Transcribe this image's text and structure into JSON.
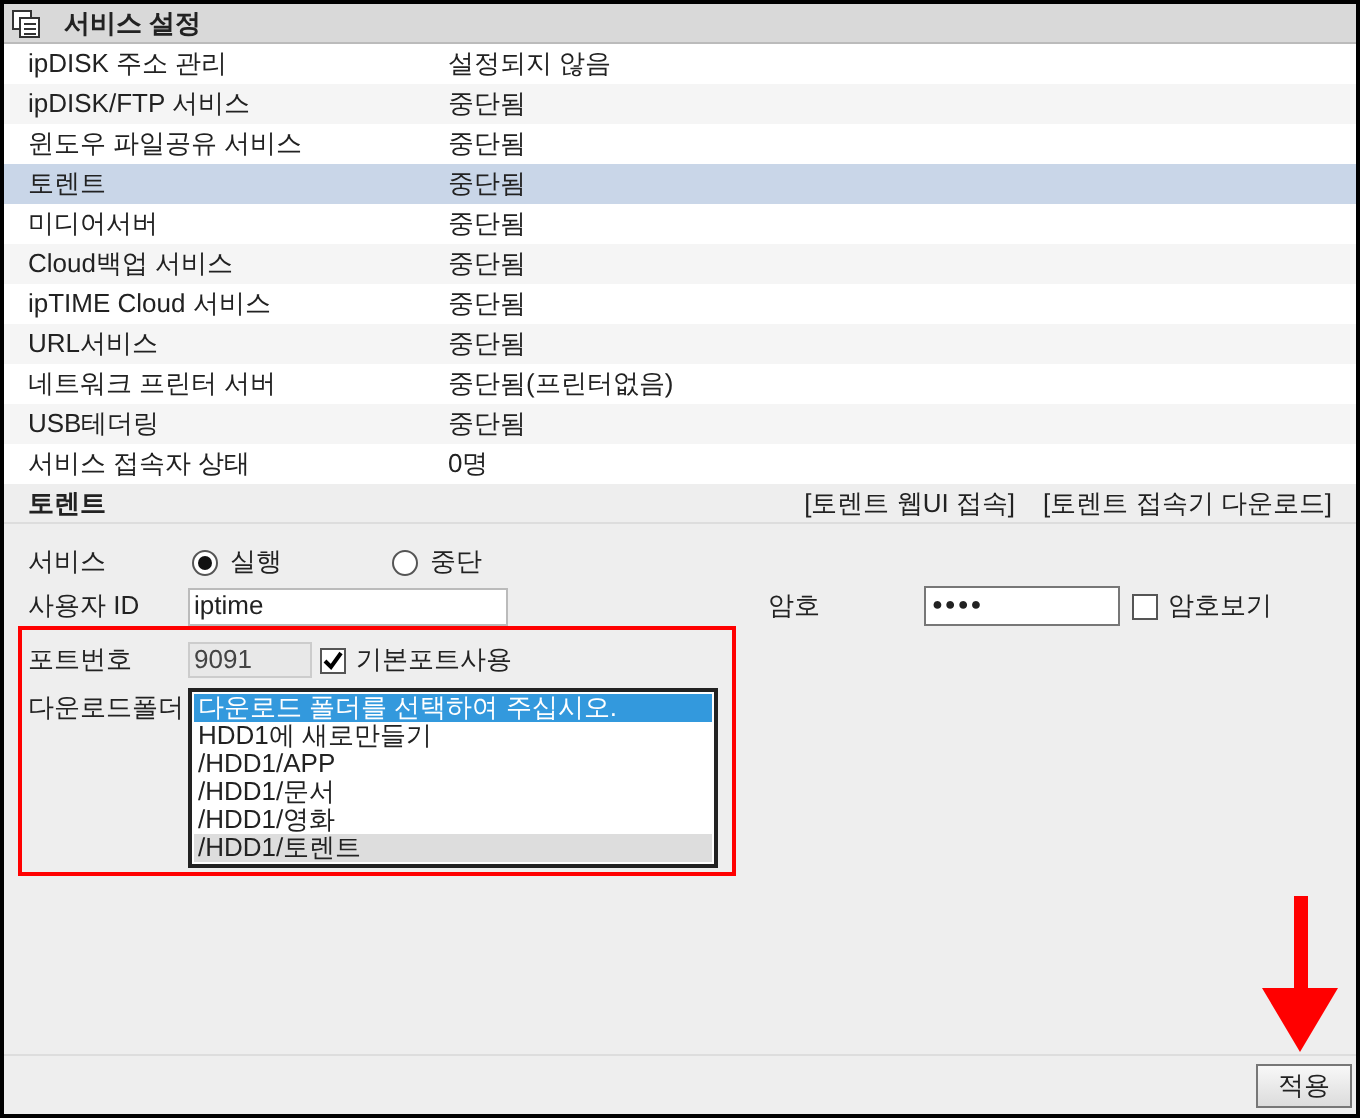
{
  "header": {
    "title": "서비스 설정"
  },
  "services": [
    {
      "name": "ipDISK 주소 관리",
      "status": "설정되지 않음",
      "selected": false
    },
    {
      "name": "ipDISK/FTP 서비스",
      "status": "중단됨",
      "selected": false
    },
    {
      "name": "윈도우 파일공유 서비스",
      "status": "중단됨",
      "selected": false
    },
    {
      "name": "토렌트",
      "status": "중단됨",
      "selected": true
    },
    {
      "name": "미디어서버",
      "status": "중단됨",
      "selected": false
    },
    {
      "name": "Cloud백업 서비스",
      "status": "중단됨",
      "selected": false
    },
    {
      "name": "ipTIME Cloud 서비스",
      "status": "중단됨",
      "selected": false
    },
    {
      "name": "URL서비스",
      "status": "중단됨",
      "selected": false
    },
    {
      "name": "네트워크 프린터 서버",
      "status": "중단됨(프린터없음)",
      "selected": false
    },
    {
      "name": "USB테더링",
      "status": "중단됨",
      "selected": false
    },
    {
      "name": "서비스 접속자 상태",
      "status": "0명",
      "selected": false
    }
  ],
  "torrent": {
    "title": "토렌트",
    "links": [
      "[토렌트 웹UI 접속]",
      "[토렌트 접속기 다운로드]"
    ],
    "service_label": "서비스",
    "service_options": [
      {
        "label": "실행",
        "selected": true
      },
      {
        "label": "중단",
        "selected": false
      }
    ],
    "user_id_label": "사용자 ID",
    "user_id": "iptime",
    "password_label": "암호",
    "password": "●●●●",
    "show_password": {
      "label": "암호보기",
      "checked": false
    },
    "port_label": "포트번호",
    "port": "9091",
    "default_port": {
      "label": "기본포트사용",
      "checked": true
    },
    "folder_label": "다운로드폴더",
    "folders": [
      {
        "label": "다운로드 폴더를 선택하여 주십시오.",
        "selected": true,
        "hovered": false
      },
      {
        "label": "HDD1에 새로만들기",
        "selected": false,
        "hovered": false
      },
      {
        "label": "/HDD1/APP",
        "selected": false,
        "hovered": false
      },
      {
        "label": "/HDD1/문서",
        "selected": false,
        "hovered": false
      },
      {
        "label": "/HDD1/영화",
        "selected": false,
        "hovered": false
      },
      {
        "label": "/HDD1/토렌트",
        "selected": false,
        "hovered": true
      }
    ]
  },
  "apply_button": "적용"
}
